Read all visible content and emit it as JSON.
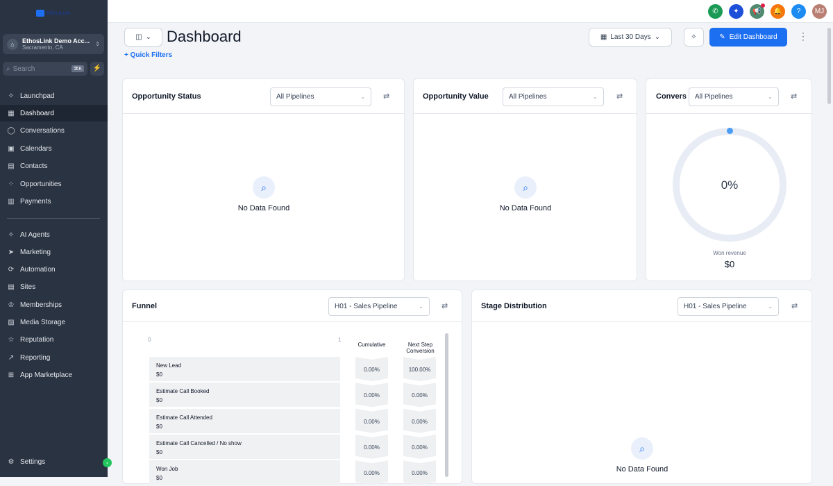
{
  "sidebar": {
    "logo": "EthosLink",
    "account_name": "EthosLink Demo Acc...",
    "account_location": "Sacramento, CA",
    "search_placeholder": "Search",
    "search_shortcut": "⌘K",
    "items": [
      {
        "label": "Launchpad",
        "icon": "rocket-icon"
      },
      {
        "label": "Dashboard",
        "icon": "grid-icon",
        "active": true
      },
      {
        "label": "Conversations",
        "icon": "chat-icon"
      },
      {
        "label": "Calendars",
        "icon": "calendar-icon"
      },
      {
        "label": "Contacts",
        "icon": "contacts-icon"
      },
      {
        "label": "Opportunities",
        "icon": "opportunities-icon"
      },
      {
        "label": "Payments",
        "icon": "payments-icon"
      }
    ],
    "items2": [
      {
        "label": "AI Agents"
      },
      {
        "label": "Marketing"
      },
      {
        "label": "Automation"
      },
      {
        "label": "Sites"
      },
      {
        "label": "Memberships"
      },
      {
        "label": "Media Storage"
      },
      {
        "label": "Reputation"
      },
      {
        "label": "Reporting"
      },
      {
        "label": "App Marketplace"
      }
    ],
    "settings": "Settings"
  },
  "topbar": {
    "avatar": "MJ",
    "help": "?",
    "colors": {
      "phone": "#1a9a55",
      "magic": "#1d4fd8",
      "announce": "#4d8a6e",
      "bell": "#f5760b",
      "help": "#1d8cf2",
      "avatar": "#b97f72"
    }
  },
  "header": {
    "title": "Dashboard",
    "quick_filters": "+ Quick Filters",
    "date_range": "Last 30 Days",
    "edit_label": "Edit Dashboard"
  },
  "cards": {
    "opp_status": {
      "title": "Opportunity Status",
      "select": "All Pipelines",
      "empty": "No Data Found"
    },
    "opp_value": {
      "title": "Opportunity Value",
      "select": "All Pipelines",
      "empty": "No Data Found"
    },
    "conversion": {
      "title": "Convers",
      "select": "All Pipelines",
      "value": "0%",
      "sub_label": "Won revenue",
      "sub_value": "$0"
    },
    "funnel": {
      "title": "Funnel",
      "select": "H01 - Sales Pipeline",
      "axis_min": "0",
      "axis_max": "1",
      "col_cumulative": "Cumulative",
      "col_next": "Next Step Conversion",
      "rows": [
        {
          "name": "New Lead",
          "value": "$0",
          "cum": "0.00%",
          "next": "100.00%"
        },
        {
          "name": "Estimate Call Booked",
          "value": "$0",
          "cum": "0.00%",
          "next": "0.00%"
        },
        {
          "name": "Estimate Call Attended",
          "value": "$0",
          "cum": "0.00%",
          "next": "0.00%"
        },
        {
          "name": "Estimate Call Cancelled / No show",
          "value": "$0",
          "cum": "0.00%",
          "next": "0.00%"
        },
        {
          "name": "Won Job",
          "value": "$0",
          "cum": "0.00%",
          "next": "0.00%"
        }
      ]
    },
    "stage": {
      "title": "Stage Distribution",
      "select": "H01 - Sales Pipeline",
      "empty": "No Data Found"
    }
  }
}
